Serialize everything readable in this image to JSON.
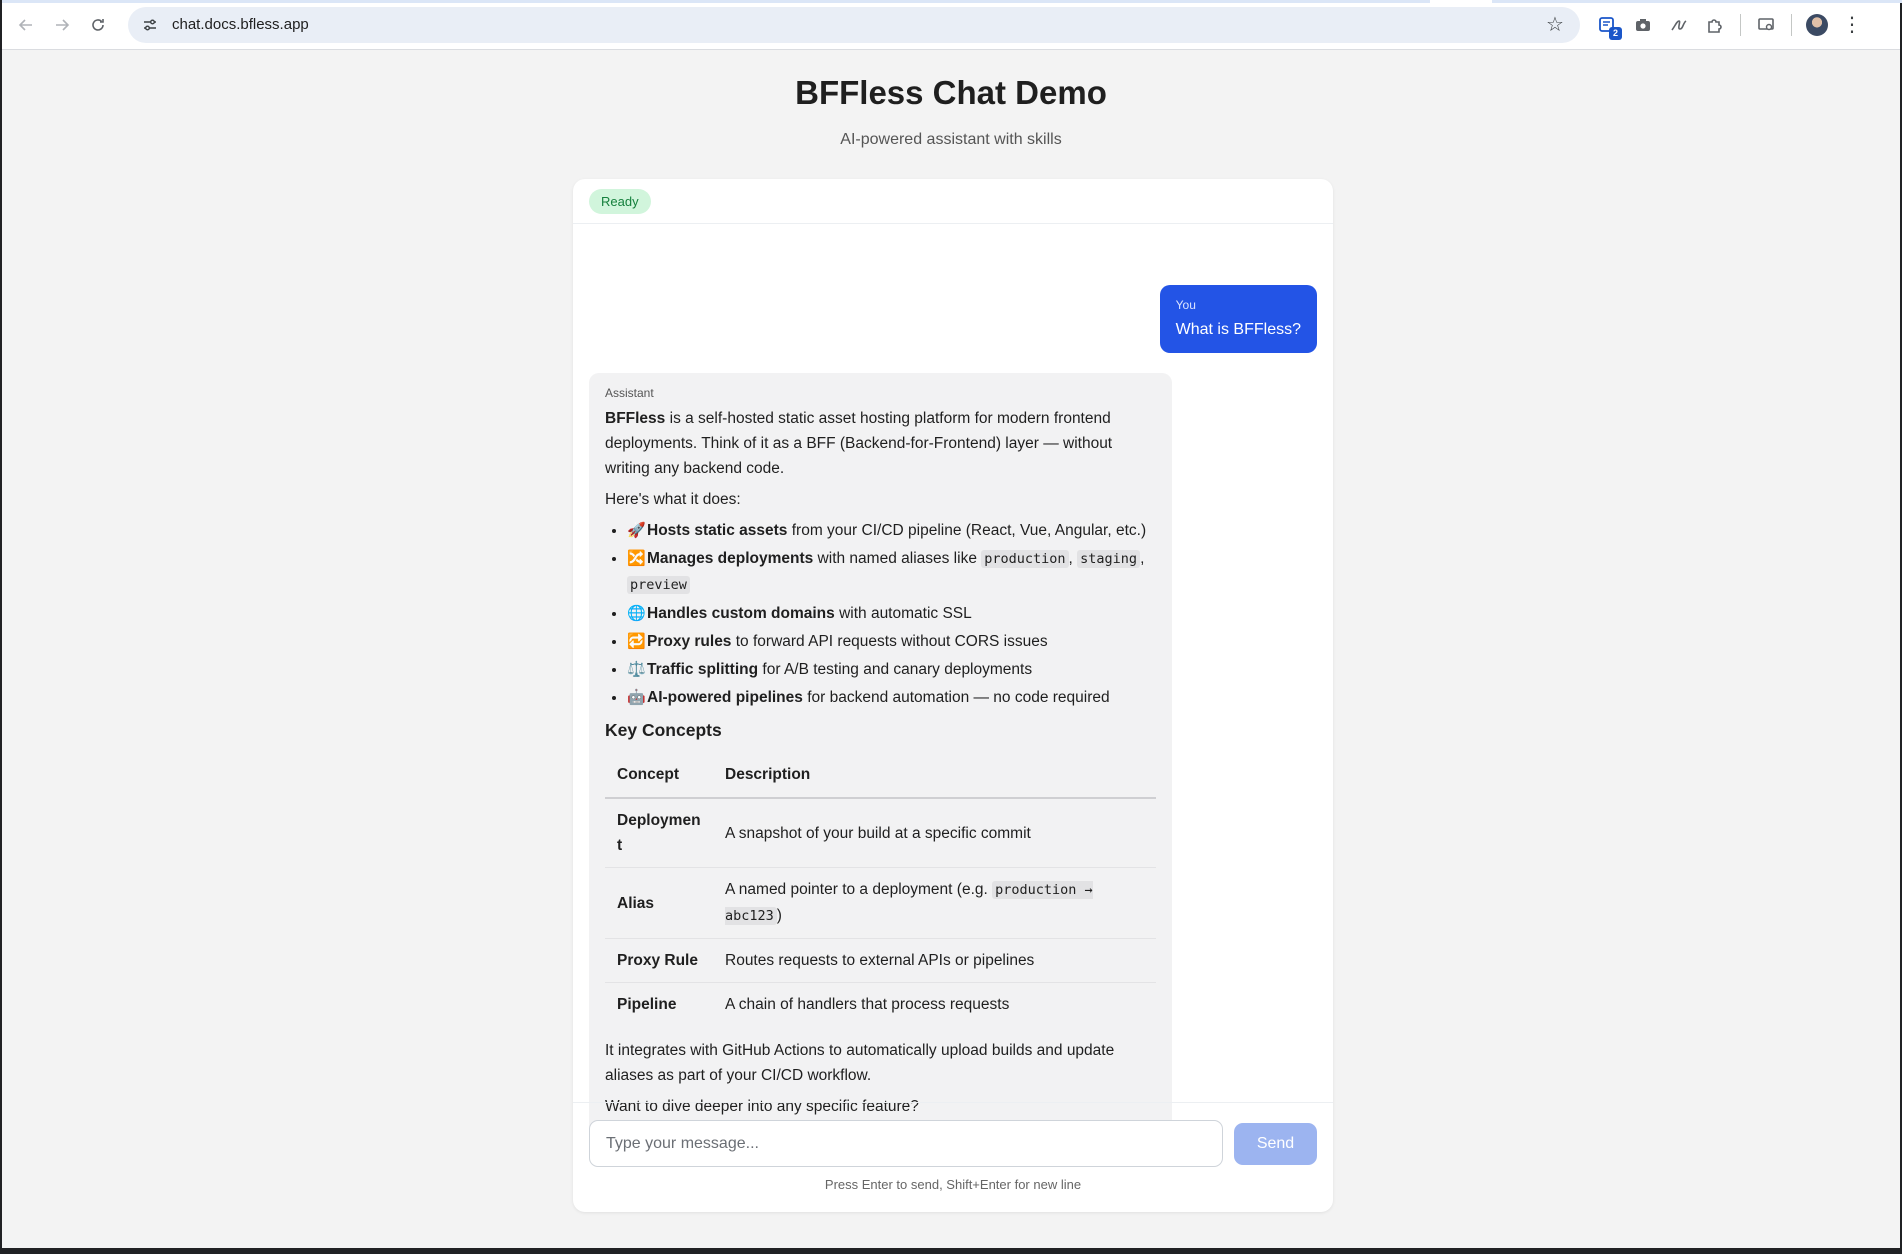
{
  "browser": {
    "url": "chat.docs.bfless.app",
    "extension_badge_count": "2"
  },
  "page": {
    "title": "BFFless Chat Demo",
    "subtitle": "AI-powered assistant with skills"
  },
  "status": {
    "label": "Ready",
    "bg_color": "#d1f5dc",
    "text_color": "#15803d"
  },
  "messages": {
    "user": {
      "role": "You",
      "text": "What is BFFless?",
      "bg_color": "#2354e6"
    },
    "assistant": {
      "role": "Assistant",
      "intro_bold": "BFFless",
      "intro_rest": " is a self-hosted static asset hosting platform for modern frontend deployments. Think of it as a BFF (Backend-for-Frontend) layer — without writing any backend code.",
      "lead": "Here's what it does:",
      "features": [
        {
          "emoji": "🚀",
          "bold": "Hosts static assets",
          "rest": " from your CI/CD pipeline (React, Vue, Angular, etc.)"
        },
        {
          "emoji": "🔀",
          "bold": "Manages deployments",
          "rest": " with named aliases like ",
          "codes": [
            "production",
            "staging",
            "preview"
          ]
        },
        {
          "emoji": "🌐",
          "bold": "Handles custom domains",
          "rest": " with automatic SSL"
        },
        {
          "emoji": "🔁",
          "bold": "Proxy rules",
          "rest": " to forward API requests without CORS issues"
        },
        {
          "emoji": "⚖️",
          "bold": "Traffic splitting",
          "rest": " for A/B testing and canary deployments"
        },
        {
          "emoji": "🤖",
          "bold": "AI-powered pipelines",
          "rest": " for backend automation — no code required"
        }
      ],
      "section_heading": "Key Concepts",
      "table": {
        "headers": [
          "Concept",
          "Description"
        ],
        "rows": [
          {
            "concept": "Deployment",
            "description": "A snapshot of your build at a specific commit"
          },
          {
            "concept": "Alias",
            "description_pre": "A named pointer to a deployment (e.g. ",
            "description_code": "production → abc123",
            "description_post": ")"
          },
          {
            "concept": "Proxy Rule",
            "description": "Routes requests to external APIs or pipelines"
          },
          {
            "concept": "Pipeline",
            "description": "A chain of handlers that process requests"
          }
        ]
      },
      "closing_1": "It integrates with GitHub Actions to automatically upload builds and update aliases as part of your CI/CD workflow.",
      "closing_2": "Want to dive deeper into any specific feature?"
    }
  },
  "composer": {
    "placeholder": "Type your message...",
    "value": "",
    "send_label": "Send",
    "hint": "Press Enter to send, Shift+Enter for new line"
  },
  "icons": {
    "back": "arrow-left-icon",
    "forward": "arrow-right-icon",
    "reload": "reload-icon",
    "site_info": "tune-icon",
    "bookmark": "star-icon",
    "extensions": [
      "extension-badge-icon",
      "camera-icon",
      "scribble-icon",
      "puzzle-icon"
    ],
    "cast": "cast-icon",
    "menu": "kebab-icon"
  }
}
